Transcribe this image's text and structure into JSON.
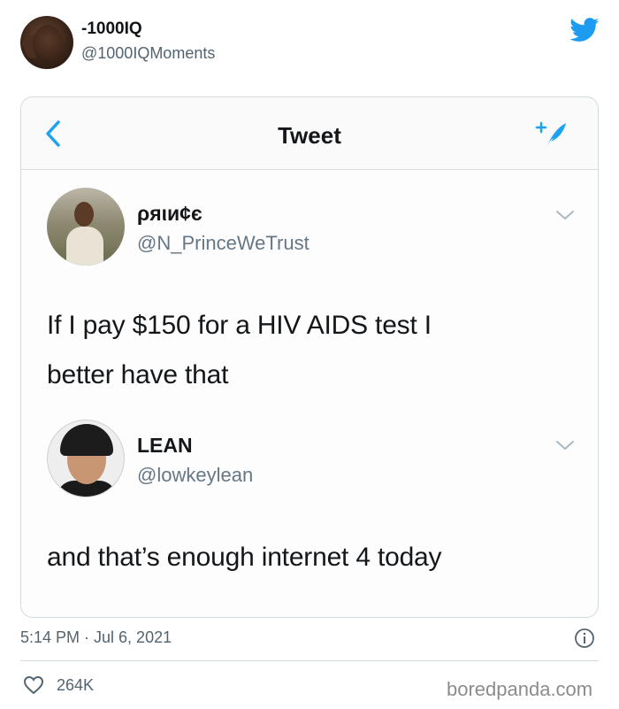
{
  "outer": {
    "display_name": "-1000IQ",
    "handle": "@1000IQMoments",
    "brand_color": "#1d9bf0"
  },
  "card": {
    "nav": {
      "title": "Tweet",
      "back_icon": "chevron-left-icon",
      "compose_icon": "compose-feather-icon",
      "accent": "#1da1f2"
    },
    "tweets": [
      {
        "name": "ℙ𝔯𝔦𝔫𝔠𝔢",
        "name_display": "ρяιи¢є",
        "handle": "@N_PrinceWeTrust",
        "text_lines": [
          "If I pay $150 for a HIV AIDS test I",
          "better have that"
        ]
      },
      {
        "name_display": "LEAN",
        "handle": "@lowkeylean",
        "text_lines": [
          "and that’s enough internet 4 today"
        ]
      }
    ]
  },
  "footer": {
    "timestamp": "5:14 PM · Jul 6, 2021",
    "like_count": "264K",
    "watermark": "boredpanda.com"
  }
}
